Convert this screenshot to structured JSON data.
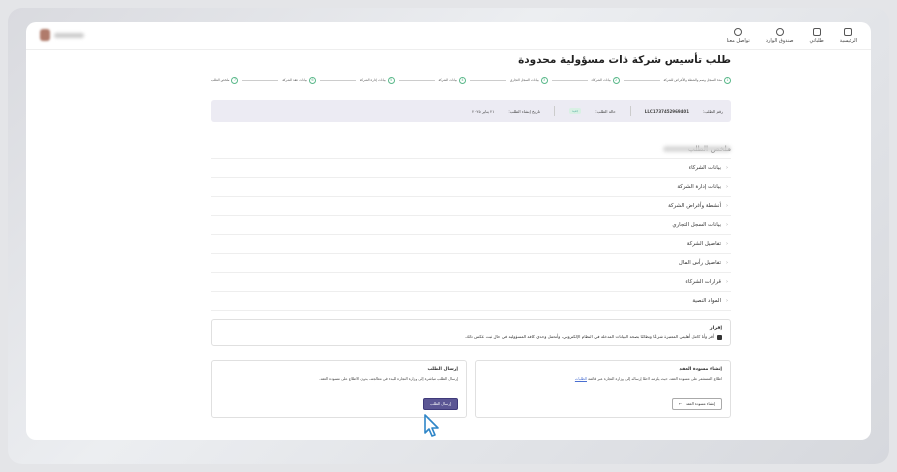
{
  "nav": {
    "items": [
      {
        "label": "الرئيسية",
        "icon": "home-icon"
      },
      {
        "label": "طلباتي",
        "icon": "document-icon"
      },
      {
        "label": "صندوق الوارد",
        "icon": "inbox-icon"
      },
      {
        "label": "تواصل معنا",
        "icon": "chat-icon"
      }
    ]
  },
  "page": {
    "title": "طلب تأسيس شركة ذات مسؤولية محدودة"
  },
  "steps": [
    {
      "num": "1",
      "label": "مدة السجل وسم والشطة والأغراض للشركة"
    },
    {
      "num": "2",
      "label": "بيانات الشركاء"
    },
    {
      "num": "3",
      "label": "بيانات السجل التجاري"
    },
    {
      "num": "4",
      "label": "بيانات الشركة"
    },
    {
      "num": "5",
      "label": "بيانات إدارة الشركة"
    },
    {
      "num": "6",
      "label": "بيانات عقد الشركة"
    },
    {
      "num": "7",
      "label": "ملخص الطلب"
    }
  ],
  "request_info": {
    "number_label": "رقم الطلب:",
    "number_value": "LLC1737452969401",
    "status_label": "حالة الطلب:",
    "status_value": "جديد",
    "date_label": "تاريخ إنشاء الطلب:",
    "date_value": "٢١ يناير ٢٠٢٥"
  },
  "summary": {
    "title": "ملخص الطلب",
    "sections": [
      "بيانات الشركاء",
      "بيانات إدارة الشركة",
      "أنشطة وأغراض الشركة",
      "بيانات السجل التجاري",
      "تفاصيل الشركة",
      "تفاصيل رأس المال",
      "قرارات الشركاء",
      "المواد النصية"
    ]
  },
  "acknowledgement": {
    "title": "إقرار",
    "text": "أقر وأنا كامل أهليتي المعتبرة شرعًا ونظامًا بصحة البيانات المدخلة في النظام الإلكتروني، وأتحمل وحدي كافة المسؤولية في حال ثبت عكس ذلك."
  },
  "draft_card": {
    "title": "إنشاء مسودة العقد",
    "text": "اطلاع المستثمر على مسودة العقد، حيث يلزمه لاحقًا إرساله إلى وزارة التجارة عبر قائمة",
    "link": "الطلبات",
    "button": "إنشاء مسودة العقد"
  },
  "submit_card": {
    "title": "إرسال الطلب",
    "text": "إرسال الطلب مباشرة إلى وزارة التجارة للبدء في معالجته، بدون الاطلاع على مسودة العقد.",
    "button": "إرسال الطلب"
  },
  "colors": {
    "accent": "#5b5694",
    "step": "#5ab88a"
  }
}
